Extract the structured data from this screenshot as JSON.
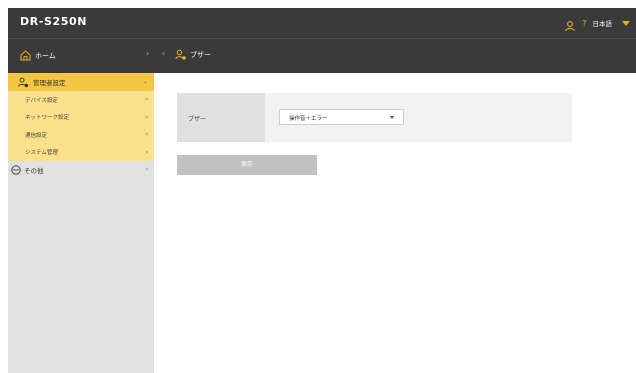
{
  "header": {
    "brand": "DR-S250N",
    "help": "?",
    "language": "日本語"
  },
  "subbar": {
    "home_label": "ホーム",
    "home_chevron": "›",
    "back_chevron": "‹",
    "current_page": "ブザー"
  },
  "sidebar": {
    "admin_section": {
      "label": "管理者設定",
      "chevron": "⌄"
    },
    "admin_items": [
      {
        "label": "デバイス設定",
        "chevron": "›"
      },
      {
        "label": "ネットワーク設定",
        "chevron": "›"
      },
      {
        "label": "通信設定",
        "chevron": "›"
      },
      {
        "label": "システム管理",
        "chevron": "›"
      }
    ],
    "other": {
      "label": "その他",
      "chevron": "›"
    }
  },
  "content": {
    "setting_label": "ブザー",
    "select_value": "操作音＋エラー",
    "save_label": "保存"
  },
  "colors": {
    "header_bg": "#3a3a3a",
    "accent": "#f3c744",
    "submenu_bg": "#fbe18c",
    "sidebar_bg": "#e1e1e1",
    "icon_accent": "#e6b422"
  },
  "icons": [
    "user-icon",
    "help-icon",
    "dropdown-caret-icon",
    "home-icon",
    "admin-user-gear-icon",
    "more-circle-icon",
    "chevron-right-icon",
    "chevron-left-icon",
    "chevron-down-icon"
  ]
}
